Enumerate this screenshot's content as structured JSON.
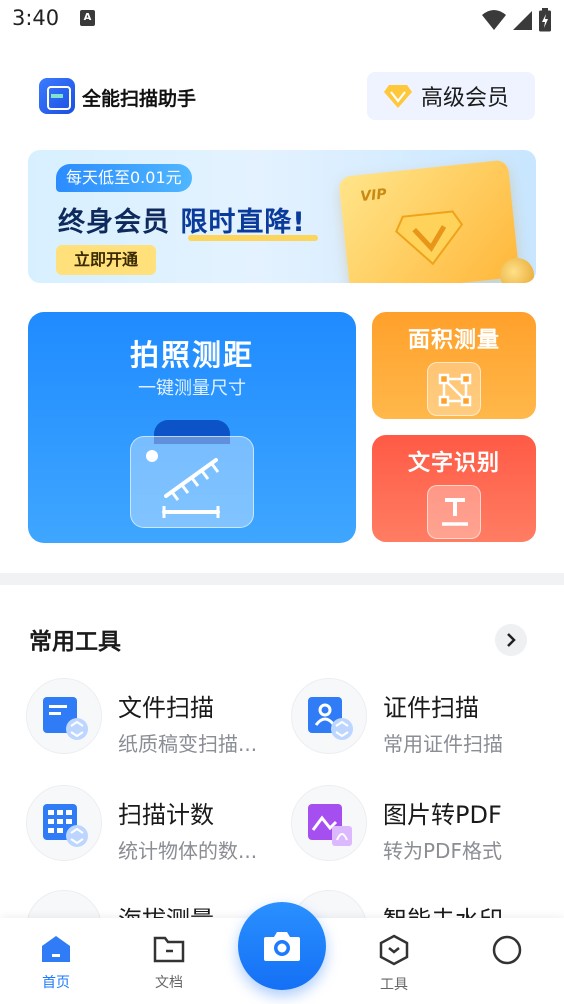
{
  "status_bar": {
    "time": "3:40",
    "notif_letter": "A"
  },
  "header": {
    "app_name": "全能扫描助手",
    "vip_label": "高级会员"
  },
  "banner": {
    "tag": "每天低至0.01元",
    "title_a": "终身会员",
    "title_b": "限时直降!",
    "button": "立即开通",
    "card_text": "VIP"
  },
  "features": {
    "main": {
      "title": "拍照测距",
      "subtitle": "一键测量尺寸"
    },
    "area": {
      "title": "面积测量"
    },
    "ocr": {
      "title": "文字识别"
    }
  },
  "tools": {
    "title": "常用工具",
    "items": [
      {
        "name": "文件扫描",
        "desc": "纸质稿变扫描..."
      },
      {
        "name": "证件扫描",
        "desc": "常用证件扫描"
      },
      {
        "name": "扫描计数",
        "desc": "统计物体的数..."
      },
      {
        "name": "图片转PDF",
        "desc": "转为PDF格式"
      },
      {
        "name": "海拔测量",
        "desc": ""
      },
      {
        "name": "智能去水印",
        "desc": ""
      }
    ]
  },
  "nav": {
    "items": [
      {
        "label": "首页",
        "icon": "home-icon"
      },
      {
        "label": "文档",
        "icon": "folder-icon"
      },
      {
        "label": "工具",
        "icon": "tools-icon"
      },
      {
        "label": "",
        "icon": "profile-icon"
      }
    ],
    "camera_icon": "camera-icon"
  },
  "colors": {
    "accent": "#1e7bff",
    "orange": "#ffa02b",
    "red": "#ff5a45"
  }
}
